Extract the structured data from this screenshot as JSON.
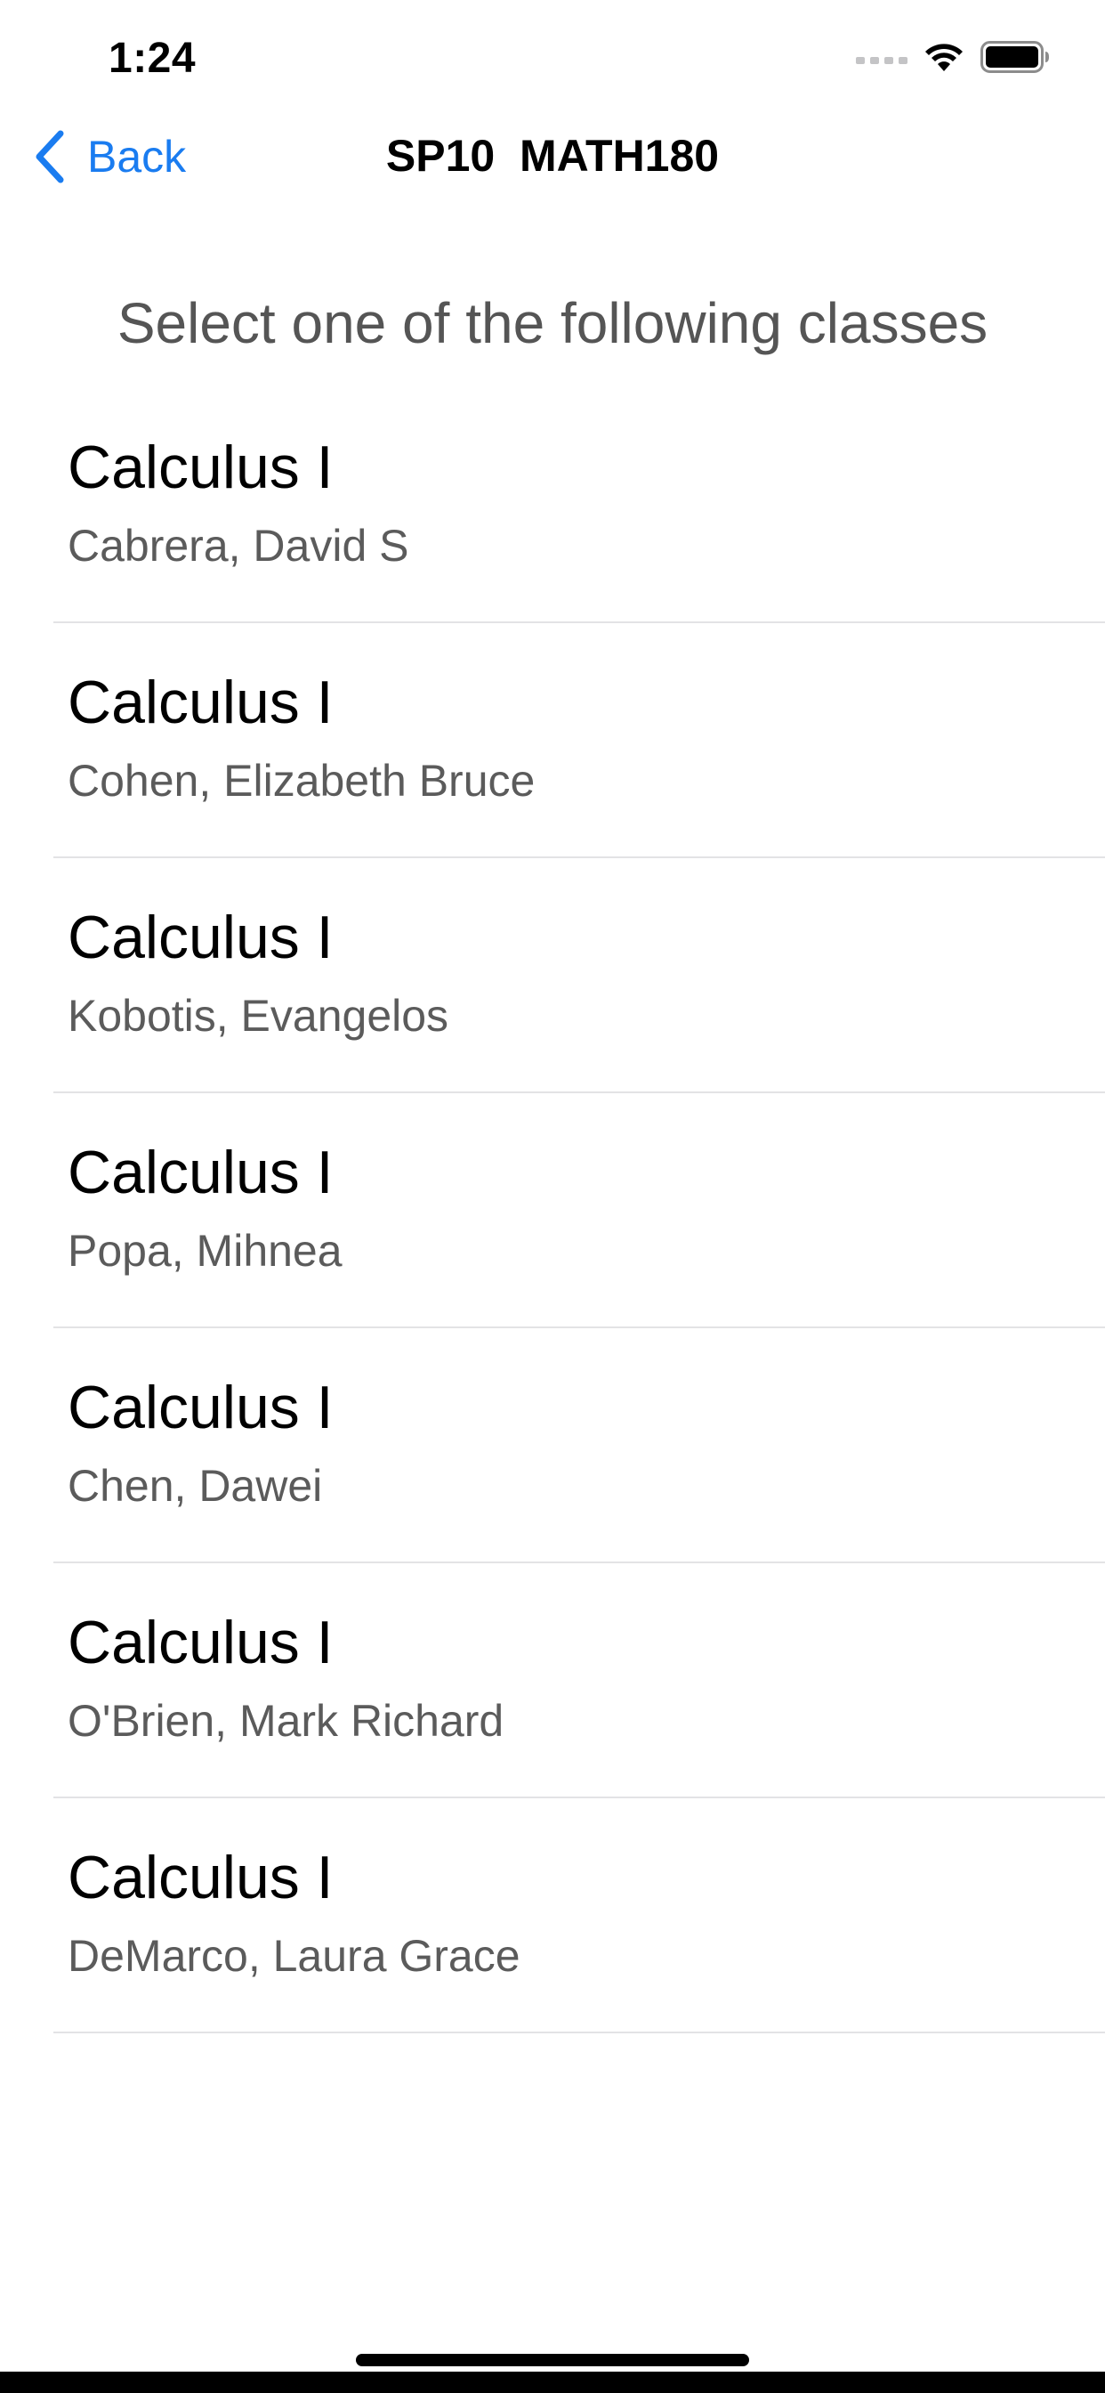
{
  "status_bar": {
    "time": "1:24",
    "icons": [
      "cellular-signal-icon",
      "wifi-icon",
      "battery-icon"
    ]
  },
  "nav": {
    "back_label": "Back",
    "title": "SP10  MATH180"
  },
  "prompt": "Select one of the following classes",
  "classes": [
    {
      "title": "Calculus I",
      "instructor": "Cabrera, David S"
    },
    {
      "title": "Calculus I",
      "instructor": "Cohen, Elizabeth Bruce"
    },
    {
      "title": "Calculus I",
      "instructor": "Kobotis, Evangelos"
    },
    {
      "title": "Calculus I",
      "instructor": "Popa, Mihnea"
    },
    {
      "title": "Calculus I",
      "instructor": "Chen, Dawei"
    },
    {
      "title": "Calculus I",
      "instructor": "O'Brien, Mark Richard"
    },
    {
      "title": "Calculus I",
      "instructor": "DeMarco, Laura Grace"
    }
  ],
  "colors": {
    "accent": "#1a7cf0",
    "secondary_text": "#5b5b5b",
    "divider": "#e3e3e5"
  }
}
